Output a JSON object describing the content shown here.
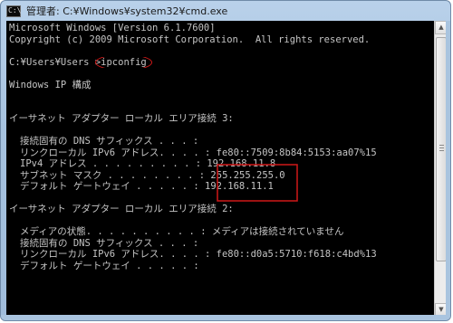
{
  "window": {
    "title": "管理者: C:¥Windows¥system32¥cmd.exe",
    "icon_label": "C:\\"
  },
  "console": {
    "lines": [
      "Microsoft Windows [Version 6.1.7600]",
      "Copyright (c) 2009 Microsoft Corporation.  All rights reserved.",
      "",
      "",
      "",
      "Windows IP 構成",
      "",
      "",
      "イーサネット アダプター ローカル エリア接続 3:",
      "",
      "接続固有の DNS サフィックス . . . :",
      "リンクローカル IPv6 アドレス. . . . : fe80::7509:8b84:5153:aa07%15",
      "IPv4 アドレス . . . . . . . . . : 192.168.11.8",
      "サブネット マスク . . . . . . . . : 255.255.255.0",
      "デフォルト ゲートウェイ . . . . . : 192.168.11.1",
      "",
      "イーサネット アダプター ローカル エリア接続 2:",
      "",
      "メディアの状態. . . . . . . . . . : メディアは接続されていません",
      "接続固有の DNS サフィックス . . . :",
      "リンクローカル IPv6 アドレス. . . . : fe80::d0a5:5710:f618:c4bd%13",
      "デフォルト ゲートウェイ . . . . . :"
    ],
    "prompt": "C:¥Users¥Users >",
    "command": "ipconfig"
  },
  "colors": {
    "console_bg": "#000000",
    "console_fg": "#c4c4c4",
    "highlight": "#d01818"
  },
  "icons": {
    "app": "cmd-icon",
    "scroll_up": "arrow-up-icon",
    "scroll_down": "arrow-down-icon"
  }
}
